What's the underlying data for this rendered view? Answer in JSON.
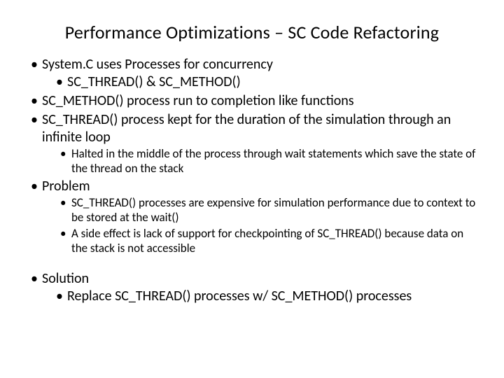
{
  "title": "Performance Optimizations – SC Code Refactoring",
  "b1": "System.C uses Processes for concurrency",
  "b1a": " SC_THREAD() & SC_METHOD()",
  "b2": "SC_METHOD() process run to completion like functions",
  "b3": "SC_THREAD() process kept for the duration of the simulation through an infinite loop",
  "b3a": "Halted in the middle of the process through wait statements which save the state of the thread on the stack",
  "b4": "Problem",
  "b4a": "SC_THREAD() processes are expensive for simulation performance due to context to be stored at the wait()",
  "b4b": "A side effect is lack of support for checkpointing of SC_THREAD() because data on the stack is not accessible",
  "b5": "Solution",
  "b5a": "Replace SC_THREAD() processes w/ SC_METHOD() processes"
}
